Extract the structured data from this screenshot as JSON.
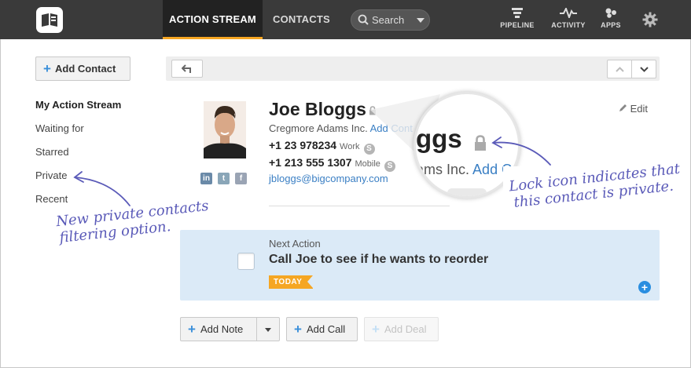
{
  "nav": {
    "tabs": [
      {
        "label": "ACTION STREAM",
        "active": true
      },
      {
        "label": "CONTACTS",
        "active": false
      }
    ],
    "search_placeholder": "Search",
    "icons": [
      {
        "label": "PIPELINE",
        "icon": "pipeline-icon"
      },
      {
        "label": "ACTIVITY",
        "icon": "activity-icon"
      },
      {
        "label": "APPS",
        "icon": "apps-icon"
      }
    ],
    "accent": "#f5a623"
  },
  "sidebar": {
    "add_contact": "Add Contact",
    "items": [
      {
        "label": "My Action Stream",
        "active": true
      },
      {
        "label": "Waiting for",
        "active": false
      },
      {
        "label": "Starred",
        "active": false
      },
      {
        "label": "Private",
        "active": false
      },
      {
        "label": "Recent",
        "active": false
      }
    ]
  },
  "contact": {
    "name": "Joe Bloggs",
    "company": "Cregmore Adams Inc.",
    "company_link": "Add Cont",
    "phones": [
      {
        "number": "+1 23 978234",
        "type": "Work"
      },
      {
        "number": "+1 213 555 1307",
        "type": "Mobile"
      }
    ],
    "email": "jbloggs@bigcompany.com",
    "edit_label": "Edit",
    "social": [
      "in",
      "t",
      "f"
    ]
  },
  "magnifier": {
    "big_text": "ggs",
    "sub_text": "ams Inc.",
    "sub_link": "Add C"
  },
  "annotations": {
    "left": [
      "New private contacts",
      "filtering option."
    ],
    "right": [
      "Lock icon indicates that",
      "this contact is private."
    ]
  },
  "next_action": {
    "label": "Next Action",
    "title": "Call Joe to see if he wants to reorder",
    "badge": "TODAY"
  },
  "buttons": {
    "add_note": "Add Note",
    "add_call": "Add Call",
    "add_deal": "Add Deal"
  }
}
